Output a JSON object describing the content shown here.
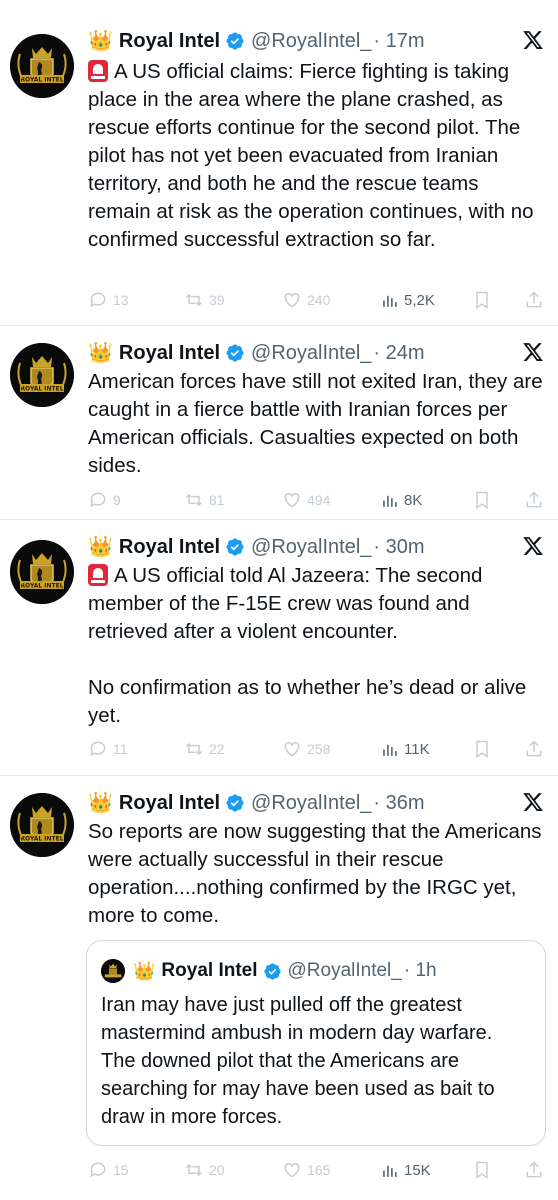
{
  "tweets": [
    {
      "name": "Royal Intel",
      "handle": "@RoyalIntel_",
      "time": "· 17m",
      "has_siren": true,
      "text": [
        "A US official claims: Fierce fighting is taking place in the area where the plane crashed, as rescue efforts continue for the second pilot. The pilot has not yet been evacuated from Iranian territory, and both he and the rescue teams remain at risk as the operation continues, with no confirmed successful extraction so far."
      ],
      "replies": "13",
      "reposts": "39",
      "likes": "240",
      "views": "5,2K"
    },
    {
      "name": "Royal Intel",
      "handle": "@RoyalIntel_",
      "time": "· 24m",
      "has_siren": false,
      "text": [
        "American forces have still not exited Iran, they are caught in a fierce battle with Iranian forces per American officials. Casualties expected on both sides."
      ],
      "replies": "9",
      "reposts": "81",
      "likes": "494",
      "views": "8K"
    },
    {
      "name": "Royal Intel",
      "handle": "@RoyalIntel_",
      "time": "· 30m",
      "has_siren": true,
      "text": [
        "A US official told Al Jazeera: The second member of the F-15E crew was found and retrieved after a violent encounter.",
        "No confirmation as to whether he’s dead or alive yet."
      ],
      "replies": "11",
      "reposts": "22",
      "likes": "258",
      "views": "11K"
    },
    {
      "name": "Royal Intel",
      "handle": "@RoyalIntel_",
      "time": "· 36m",
      "has_siren": false,
      "text": [
        "So reports are now suggesting that the Americans were actually successful in their rescue operation....nothing confirmed by the IRGC yet, more to come."
      ],
      "replies": "15",
      "reposts": "20",
      "likes": "165",
      "views": "15K",
      "quote": {
        "name": "Royal Intel",
        "handle": "@RoyalIntel_",
        "time": "· 1h",
        "text": "Iran may have just pulled off the greatest mastermind ambush in modern day warfare. The downed pilot that the Americans are searching for may have been used as bait to draw in more forces."
      }
    }
  ],
  "avatar_text": "ROYAL INTEL",
  "colors": {
    "verified": "#1d9bf0",
    "siren": "#e0283d",
    "muted": "#536471"
  }
}
